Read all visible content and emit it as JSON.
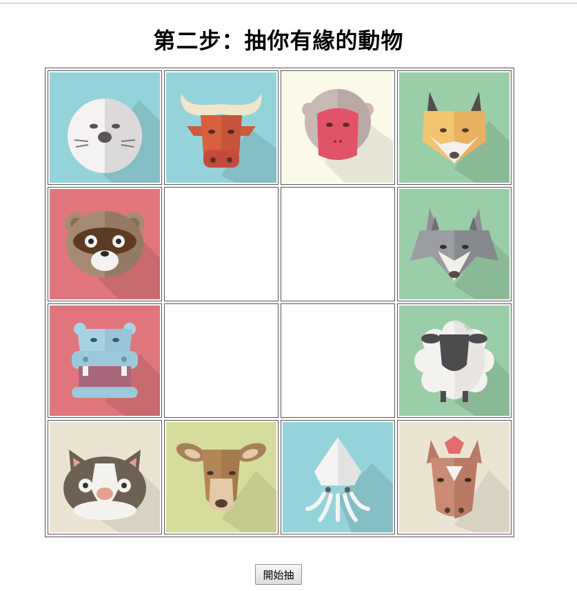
{
  "title": "第二步：抽你有緣的動物",
  "start_button": "開始抽",
  "colors": {
    "blue": "#95d3db",
    "cream": "#fbf9e8",
    "green": "#9acea8",
    "red": "#e0767c",
    "beige": "#ebe4d3",
    "olive": "#d6dd9c"
  },
  "grid": [
    [
      {
        "animal": "seal",
        "icon": "seal-icon",
        "bg": "blue"
      },
      {
        "animal": "ox",
        "icon": "ox-icon",
        "bg": "blue"
      },
      {
        "animal": "monkey",
        "icon": "monkey-icon",
        "bg": "cream"
      },
      {
        "animal": "fox",
        "icon": "fox-icon",
        "bg": "green"
      }
    ],
    [
      {
        "animal": "raccoon-dog",
        "icon": "raccoon-dog-icon",
        "bg": "red"
      },
      {
        "animal": "",
        "icon": "",
        "bg": ""
      },
      {
        "animal": "",
        "icon": "",
        "bg": ""
      },
      {
        "animal": "wolf",
        "icon": "wolf-icon",
        "bg": "green"
      }
    ],
    [
      {
        "animal": "hippo",
        "icon": "hippo-icon",
        "bg": "red"
      },
      {
        "animal": "",
        "icon": "",
        "bg": ""
      },
      {
        "animal": "",
        "icon": "",
        "bg": ""
      },
      {
        "animal": "sheep",
        "icon": "sheep-icon",
        "bg": "green"
      }
    ],
    [
      {
        "animal": "cat",
        "icon": "cat-icon",
        "bg": "beige"
      },
      {
        "animal": "deer",
        "icon": "deer-icon",
        "bg": "olive"
      },
      {
        "animal": "squid",
        "icon": "squid-icon",
        "bg": "blue"
      },
      {
        "animal": "horse",
        "icon": "horse-icon",
        "bg": "beige"
      }
    ]
  ]
}
